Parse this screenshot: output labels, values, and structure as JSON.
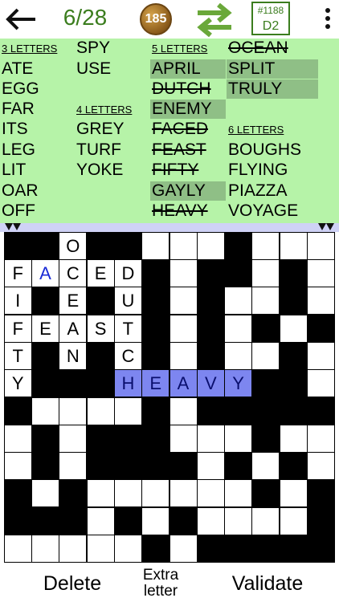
{
  "header": {
    "back_icon": "arrow-left-icon",
    "progress": "6/28",
    "coins": "185",
    "swap_icon": "swap-arrows-icon",
    "puzzle_number": "#1188",
    "puzzle_level": "D2",
    "menu_icon": "vertical-dots-icon"
  },
  "wordlist": {
    "groups": [
      {
        "heading": "3 LETTERS",
        "words": [
          "ATE",
          "EGG",
          "FAR",
          "ITS",
          "LEG",
          "LIT",
          "OAR",
          "OFF",
          "SPY",
          "USE"
        ]
      },
      {
        "heading": "4 LETTERS",
        "words": [
          "GREY",
          "TURF",
          "YOKE"
        ]
      },
      {
        "heading": "5 LETTERS",
        "words": [
          "APRIL",
          "DUTCH",
          "ENEMY",
          "FACED",
          "FEAST",
          "FIFTY",
          "GAYLY",
          "HEAVY",
          "OCEAN",
          "SPLIT",
          "TRULY"
        ]
      },
      {
        "heading": "6 LETTERS",
        "words": [
          "BOUGHS",
          "FLYING",
          "PIAZZA",
          "VOYAGE"
        ]
      }
    ]
  },
  "grid": {
    "size": 12,
    "filled_letters": [
      {
        "r": 0,
        "c": 2,
        "ch": "O"
      },
      {
        "r": 1,
        "c": 0,
        "ch": "F"
      },
      {
        "r": 1,
        "c": 1,
        "ch": "A",
        "style": "blue"
      },
      {
        "r": 1,
        "c": 2,
        "ch": "C"
      },
      {
        "r": 1,
        "c": 3,
        "ch": "E"
      },
      {
        "r": 1,
        "c": 4,
        "ch": "D"
      },
      {
        "r": 2,
        "c": 0,
        "ch": "I"
      },
      {
        "r": 2,
        "c": 2,
        "ch": "E"
      },
      {
        "r": 2,
        "c": 4,
        "ch": "U"
      },
      {
        "r": 3,
        "c": 0,
        "ch": "F"
      },
      {
        "r": 3,
        "c": 1,
        "ch": "E"
      },
      {
        "r": 3,
        "c": 2,
        "ch": "A"
      },
      {
        "r": 3,
        "c": 3,
        "ch": "S"
      },
      {
        "r": 3,
        "c": 4,
        "ch": "T"
      },
      {
        "r": 4,
        "c": 0,
        "ch": "T"
      },
      {
        "r": 4,
        "c": 2,
        "ch": "N"
      },
      {
        "r": 4,
        "c": 4,
        "ch": "C"
      },
      {
        "r": 5,
        "c": 0,
        "ch": "Y"
      },
      {
        "r": 5,
        "c": 4,
        "ch": "H",
        "style": "hi"
      },
      {
        "r": 5,
        "c": 5,
        "ch": "E",
        "style": "hi"
      },
      {
        "r": 5,
        "c": 6,
        "ch": "A",
        "style": "hi"
      },
      {
        "r": 5,
        "c": 7,
        "ch": "V",
        "style": "hi"
      },
      {
        "r": 5,
        "c": 8,
        "ch": "Y",
        "style": "hi"
      }
    ]
  },
  "footer": {
    "delete_label": "Delete",
    "extra_label_line1": "Extra",
    "extra_label_line2": "letter",
    "validate_label": "Validate"
  },
  "colors": {
    "panel_bg": "#b6f3a8",
    "placed_word_bg": "#8fbf86",
    "highlight_cell": "#7d86f0",
    "accent_green": "#3b7d1e"
  }
}
